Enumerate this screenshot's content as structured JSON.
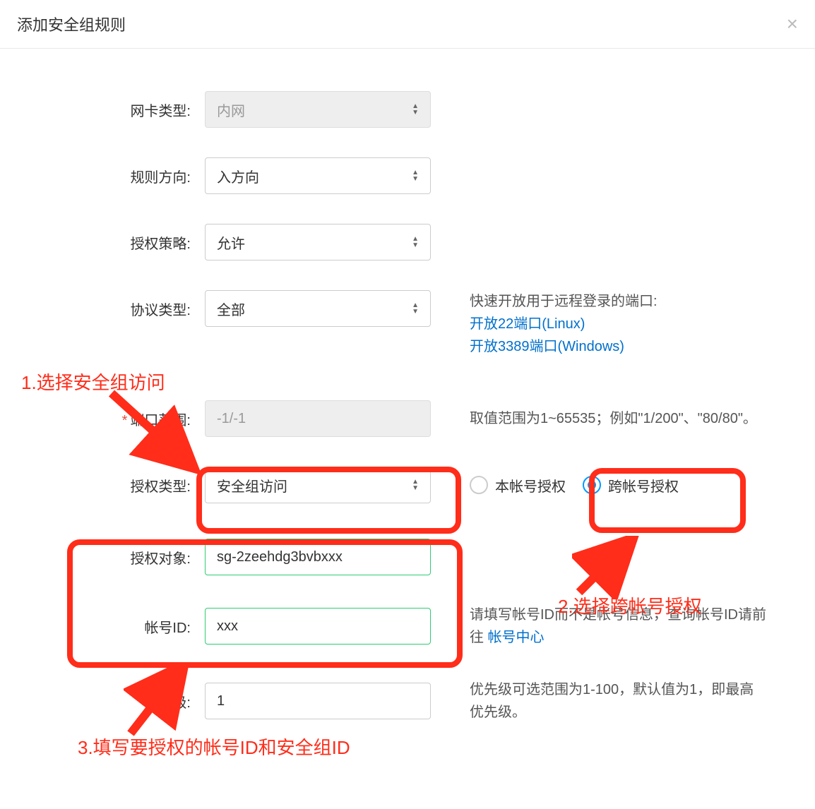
{
  "dialog": {
    "title": "添加安全组规则"
  },
  "fields": {
    "nic_type": {
      "label": "网卡类型:",
      "value": "内网"
    },
    "direction": {
      "label": "规则方向:",
      "value": "入方向"
    },
    "policy": {
      "label": "授权策略:",
      "value": "允许"
    },
    "protocol": {
      "label": "协议类型:",
      "value": "全部",
      "help_intro": "快速开放用于远程登录的端口:",
      "link1": "开放22端口(Linux)",
      "link2": "开放3389端口(Windows)"
    },
    "port_range": {
      "label": "端口范围:",
      "required_mark": "*",
      "value": "-1/-1",
      "help": "取值范围为1~65535；例如\"1/200\"、\"80/80\"。"
    },
    "auth_type": {
      "label": "授权类型:",
      "value": "安全组访问",
      "radio1": "本帐号授权",
      "radio2": "跨帐号授权"
    },
    "auth_object": {
      "label": "授权对象:",
      "value": "sg-2zeehdg3bvbxxx"
    },
    "account_id": {
      "label": "帐号ID:",
      "value": "xxx",
      "help_pre": "请填写帐号ID而不是帐号信息，查询帐号ID请前往 ",
      "help_link": "帐号中心"
    },
    "priority": {
      "label": "优先级:",
      "value": "1",
      "help": "优先级可选范围为1-100，默认值为1，即最高优先级。"
    }
  },
  "annotations": {
    "a1": "1.选择安全组访问",
    "a2": "2.选择跨帐号授权",
    "a3": "3.填写要授权的帐号ID和安全组ID"
  }
}
